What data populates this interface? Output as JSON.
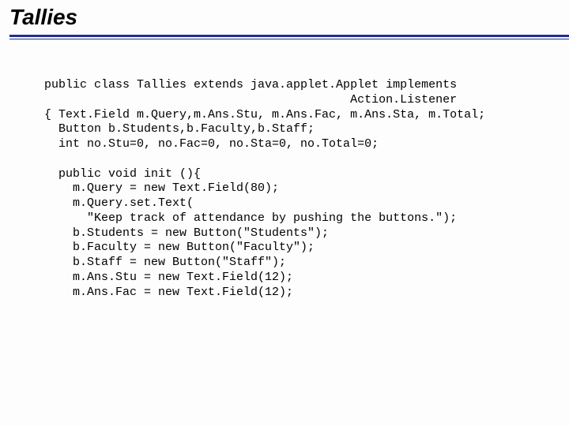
{
  "slide": {
    "title": "Tallies",
    "code_lines": [
      "public class Tallies extends java.applet.Applet implements",
      "                                           Action.Listener",
      "{ Text.Field m.Query,m.Ans.Stu, m.Ans.Fac, m.Ans.Sta, m.Total;",
      "  Button b.Students,b.Faculty,b.Staff;",
      "  int no.Stu=0, no.Fac=0, no.Sta=0, no.Total=0;",
      "",
      "  public void init (){",
      "    m.Query = new Text.Field(80);",
      "    m.Query.set.Text(",
      "      \"Keep track of attendance by pushing the buttons.\");",
      "    b.Students = new Button(\"Students\");",
      "    b.Faculty = new Button(\"Faculty\");",
      "    b.Staff = new Button(\"Staff\");",
      "    m.Ans.Stu = new Text.Field(12);",
      "    m.Ans.Fac = new Text.Field(12);"
    ]
  }
}
